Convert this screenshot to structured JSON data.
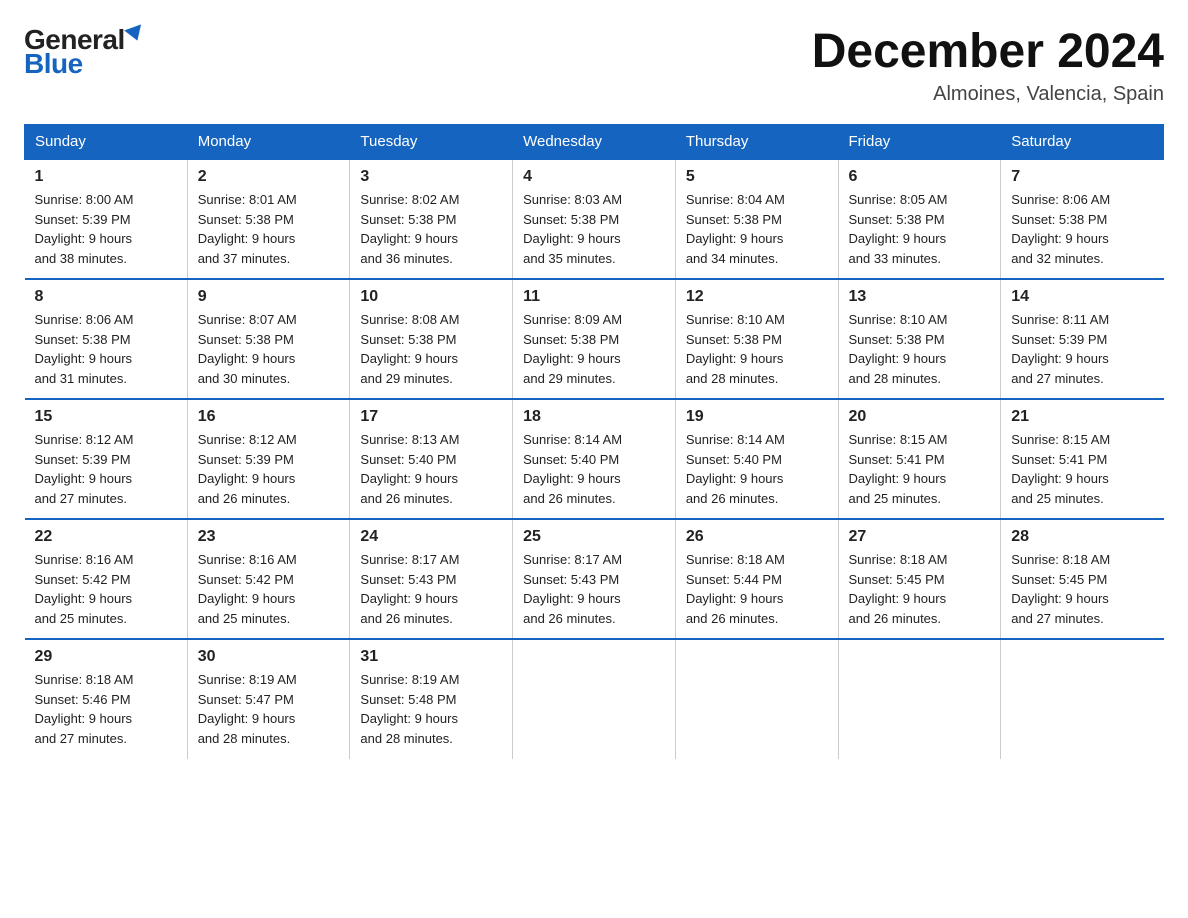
{
  "logo": {
    "general": "General",
    "blue": "Blue"
  },
  "title": "December 2024",
  "subtitle": "Almoines, Valencia, Spain",
  "weekdays": [
    "Sunday",
    "Monday",
    "Tuesday",
    "Wednesday",
    "Thursday",
    "Friday",
    "Saturday"
  ],
  "weeks": [
    [
      {
        "day": "1",
        "sunrise": "8:00 AM",
        "sunset": "5:39 PM",
        "daylight": "9 hours and 38 minutes."
      },
      {
        "day": "2",
        "sunrise": "8:01 AM",
        "sunset": "5:38 PM",
        "daylight": "9 hours and 37 minutes."
      },
      {
        "day": "3",
        "sunrise": "8:02 AM",
        "sunset": "5:38 PM",
        "daylight": "9 hours and 36 minutes."
      },
      {
        "day": "4",
        "sunrise": "8:03 AM",
        "sunset": "5:38 PM",
        "daylight": "9 hours and 35 minutes."
      },
      {
        "day": "5",
        "sunrise": "8:04 AM",
        "sunset": "5:38 PM",
        "daylight": "9 hours and 34 minutes."
      },
      {
        "day": "6",
        "sunrise": "8:05 AM",
        "sunset": "5:38 PM",
        "daylight": "9 hours and 33 minutes."
      },
      {
        "day": "7",
        "sunrise": "8:06 AM",
        "sunset": "5:38 PM",
        "daylight": "9 hours and 32 minutes."
      }
    ],
    [
      {
        "day": "8",
        "sunrise": "8:06 AM",
        "sunset": "5:38 PM",
        "daylight": "9 hours and 31 minutes."
      },
      {
        "day": "9",
        "sunrise": "8:07 AM",
        "sunset": "5:38 PM",
        "daylight": "9 hours and 30 minutes."
      },
      {
        "day": "10",
        "sunrise": "8:08 AM",
        "sunset": "5:38 PM",
        "daylight": "9 hours and 29 minutes."
      },
      {
        "day": "11",
        "sunrise": "8:09 AM",
        "sunset": "5:38 PM",
        "daylight": "9 hours and 29 minutes."
      },
      {
        "day": "12",
        "sunrise": "8:10 AM",
        "sunset": "5:38 PM",
        "daylight": "9 hours and 28 minutes."
      },
      {
        "day": "13",
        "sunrise": "8:10 AM",
        "sunset": "5:38 PM",
        "daylight": "9 hours and 28 minutes."
      },
      {
        "day": "14",
        "sunrise": "8:11 AM",
        "sunset": "5:39 PM",
        "daylight": "9 hours and 27 minutes."
      }
    ],
    [
      {
        "day": "15",
        "sunrise": "8:12 AM",
        "sunset": "5:39 PM",
        "daylight": "9 hours and 27 minutes."
      },
      {
        "day": "16",
        "sunrise": "8:12 AM",
        "sunset": "5:39 PM",
        "daylight": "9 hours and 26 minutes."
      },
      {
        "day": "17",
        "sunrise": "8:13 AM",
        "sunset": "5:40 PM",
        "daylight": "9 hours and 26 minutes."
      },
      {
        "day": "18",
        "sunrise": "8:14 AM",
        "sunset": "5:40 PM",
        "daylight": "9 hours and 26 minutes."
      },
      {
        "day": "19",
        "sunrise": "8:14 AM",
        "sunset": "5:40 PM",
        "daylight": "9 hours and 26 minutes."
      },
      {
        "day": "20",
        "sunrise": "8:15 AM",
        "sunset": "5:41 PM",
        "daylight": "9 hours and 25 minutes."
      },
      {
        "day": "21",
        "sunrise": "8:15 AM",
        "sunset": "5:41 PM",
        "daylight": "9 hours and 25 minutes."
      }
    ],
    [
      {
        "day": "22",
        "sunrise": "8:16 AM",
        "sunset": "5:42 PM",
        "daylight": "9 hours and 25 minutes."
      },
      {
        "day": "23",
        "sunrise": "8:16 AM",
        "sunset": "5:42 PM",
        "daylight": "9 hours and 25 minutes."
      },
      {
        "day": "24",
        "sunrise": "8:17 AM",
        "sunset": "5:43 PM",
        "daylight": "9 hours and 26 minutes."
      },
      {
        "day": "25",
        "sunrise": "8:17 AM",
        "sunset": "5:43 PM",
        "daylight": "9 hours and 26 minutes."
      },
      {
        "day": "26",
        "sunrise": "8:18 AM",
        "sunset": "5:44 PM",
        "daylight": "9 hours and 26 minutes."
      },
      {
        "day": "27",
        "sunrise": "8:18 AM",
        "sunset": "5:45 PM",
        "daylight": "9 hours and 26 minutes."
      },
      {
        "day": "28",
        "sunrise": "8:18 AM",
        "sunset": "5:45 PM",
        "daylight": "9 hours and 27 minutes."
      }
    ],
    [
      {
        "day": "29",
        "sunrise": "8:18 AM",
        "sunset": "5:46 PM",
        "daylight": "9 hours and 27 minutes."
      },
      {
        "day": "30",
        "sunrise": "8:19 AM",
        "sunset": "5:47 PM",
        "daylight": "9 hours and 28 minutes."
      },
      {
        "day": "31",
        "sunrise": "8:19 AM",
        "sunset": "5:48 PM",
        "daylight": "9 hours and 28 minutes."
      },
      null,
      null,
      null,
      null
    ]
  ],
  "labels": {
    "sunrise": "Sunrise:",
    "sunset": "Sunset:",
    "daylight": "Daylight:"
  }
}
